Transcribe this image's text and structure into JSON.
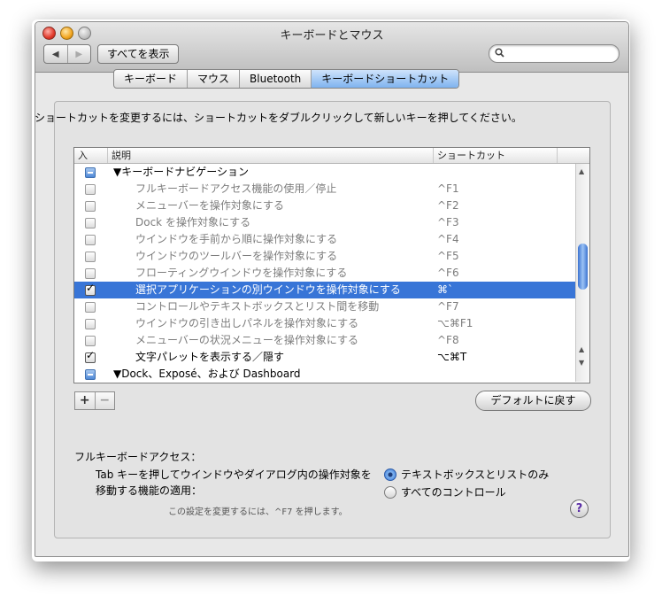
{
  "window": {
    "title": "キーボードとマウス"
  },
  "toolbar": {
    "back_icon": "◀",
    "forward_icon": "▶",
    "show_all": "すべてを表示",
    "search_placeholder": ""
  },
  "tabs": [
    {
      "label": "キーボード",
      "active": false
    },
    {
      "label": "マウス",
      "active": false
    },
    {
      "label": "Bluetooth",
      "active": false
    },
    {
      "label": "キーボードショートカット",
      "active": true
    }
  ],
  "instruction": "ショートカットを変更するには、ショートカットをダブルクリックして新しいキーを押してください。",
  "table": {
    "columns": [
      "入",
      "説明",
      "ショートカット"
    ],
    "rows": [
      {
        "type": "group",
        "state": "mixed",
        "label": "▼キーボードナビゲーション",
        "shortcut": ""
      },
      {
        "type": "item",
        "state": "off",
        "label": "フルキーボードアクセス機能の使用／停止",
        "shortcut": "^F1"
      },
      {
        "type": "item",
        "state": "off",
        "label": "メニューバーを操作対象にする",
        "shortcut": "^F2"
      },
      {
        "type": "item",
        "state": "off",
        "label": "Dock を操作対象にする",
        "shortcut": "^F3"
      },
      {
        "type": "item",
        "state": "off",
        "label": "ウインドウを手前から順に操作対象にする",
        "shortcut": "^F4"
      },
      {
        "type": "item",
        "state": "off",
        "label": "ウインドウのツールバーを操作対象にする",
        "shortcut": "^F5"
      },
      {
        "type": "item",
        "state": "off",
        "label": "フローティングウインドウを操作対象にする",
        "shortcut": "^F6"
      },
      {
        "type": "item",
        "state": "checked",
        "selected": true,
        "label": "選択アプリケーションの別ウインドウを操作対象にする",
        "shortcut": "⌘`"
      },
      {
        "type": "item",
        "state": "off",
        "label": "コントロールやテキストボックスとリスト間を移動",
        "shortcut": "^F7"
      },
      {
        "type": "item",
        "state": "off",
        "label": "ウインドウの引き出しパネルを操作対象にする",
        "shortcut": "⌥⌘F1"
      },
      {
        "type": "item",
        "state": "off",
        "label": "メニューバーの状況メニューを操作対象にする",
        "shortcut": "^F8"
      },
      {
        "type": "item",
        "state": "checked",
        "label": "文字パレットを表示する／隠す",
        "shortcut": "⌥⌘T"
      },
      {
        "type": "group",
        "state": "mixed",
        "label": "▼Dock、Exposé、および Dashboard",
        "shortcut": ""
      }
    ]
  },
  "buttons": {
    "add": "+",
    "remove": "−",
    "defaults": "デフォルトに戻す"
  },
  "full_keyboard_access": {
    "heading": "フルキーボードアクセス：",
    "description": "Tab キーを押してウインドウやダイアログ内の操作対象を移動する機能の適用：",
    "options": [
      {
        "label": "テキストボックスとリストのみ",
        "selected": true
      },
      {
        "label": "すべてのコントロール",
        "selected": false
      }
    ],
    "hint": "この設定を変更するには、^F7 を押します。"
  },
  "help": "?"
}
